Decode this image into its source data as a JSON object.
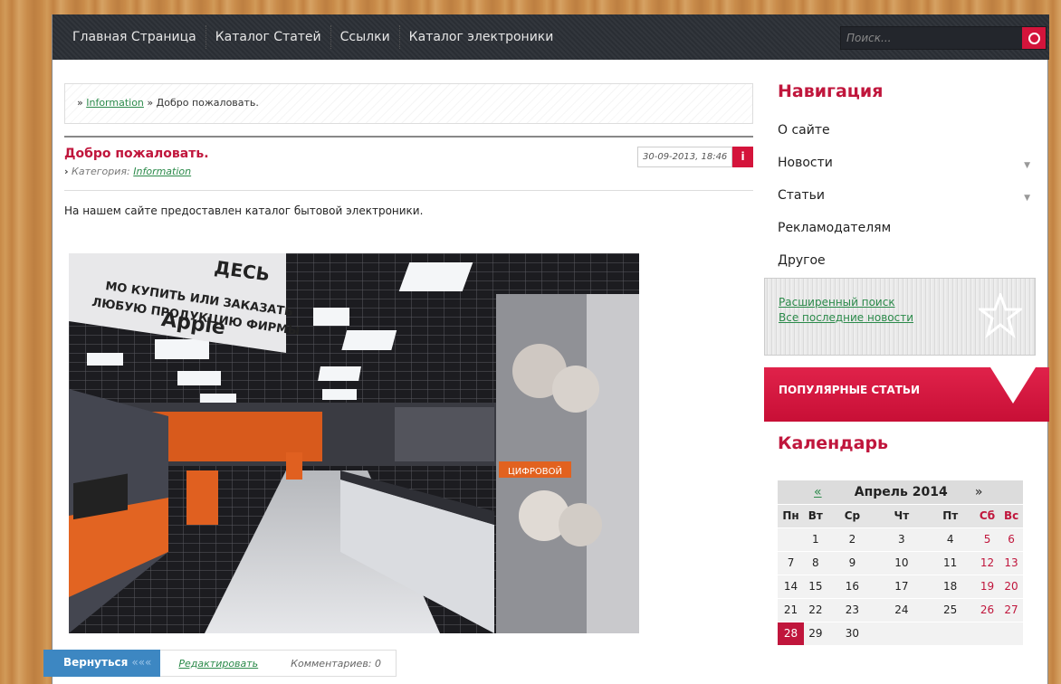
{
  "topnav": {
    "items": [
      "Главная Страница",
      "Каталог Статей",
      "Ссылки",
      "Каталог электроники"
    ],
    "search_placeholder": "Поиск..."
  },
  "breadcrumb": {
    "prefix": "»",
    "link": "Information",
    "sep": "»",
    "current": "Добро пожаловать."
  },
  "article": {
    "title": "Добро пожаловать.",
    "category_label": "Категория:",
    "category": "Information",
    "date": "30-09-2013, 18:46",
    "info_label": "i",
    "text": "На нашем сайте предоставлен каталог бытовой электроники.",
    "photo_text": {
      "line1": "ДЕСЬ",
      "line2": "МО КУПИТЬ ИЛИ ЗАКАЗАТЬ",
      "line3": "ЛЮБУЮ ПРОДУКЦИЮ ФИРМЫ",
      "brand": "Apple",
      "sign": "ЦИФРОВОЙ"
    }
  },
  "actions": {
    "back": "Вернуться",
    "back_arrows": "«««",
    "edit": "Редактировать",
    "comments": "Комментариев: 0"
  },
  "sidebar": {
    "nav_title": "Навигация",
    "menu": [
      {
        "label": "О сайте",
        "arrow": ""
      },
      {
        "label": "Новости",
        "arrow": "▼"
      },
      {
        "label": "Статьи",
        "arrow": "▼"
      },
      {
        "label": "Рекламодателям",
        "arrow": ""
      },
      {
        "label": "Другое",
        "arrow": ""
      }
    ],
    "links": [
      "Расширенный поиск",
      "Все последние новости"
    ],
    "popular_title": "ПОПУЛЯРНЫЕ СТАТЬИ",
    "calendar_title": "Календарь"
  },
  "calendar": {
    "prev": "«",
    "month": "Апрель 2014",
    "next": "»",
    "days": [
      "Пн",
      "Вт",
      "Ср",
      "Чт",
      "Пт",
      "Сб",
      "Вс"
    ],
    "weeks": [
      [
        "",
        "1",
        "2",
        "3",
        "4",
        "5",
        "6"
      ],
      [
        "7",
        "8",
        "9",
        "10",
        "11",
        "12",
        "13"
      ],
      [
        "14",
        "15",
        "16",
        "17",
        "18",
        "19",
        "20"
      ],
      [
        "21",
        "22",
        "23",
        "24",
        "25",
        "26",
        "27"
      ],
      [
        "28",
        "29",
        "30",
        "",
        "",
        "",
        ""
      ]
    ],
    "today": "28"
  },
  "colors": {
    "accent": "#c0163c",
    "link": "#2b8a4a",
    "back_button": "#3d87c2",
    "topbar": "#2b2f36"
  }
}
